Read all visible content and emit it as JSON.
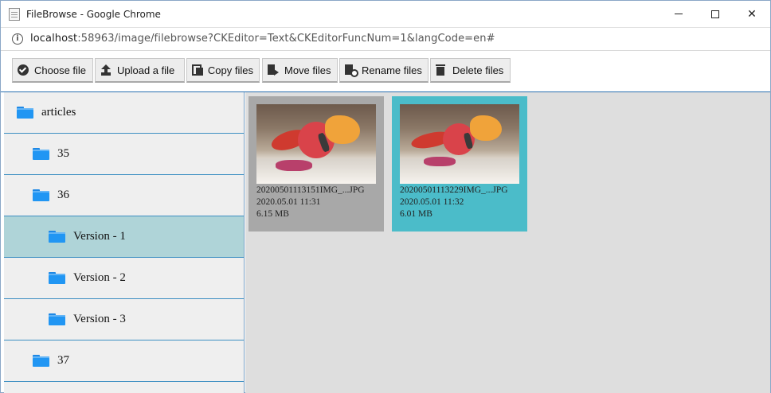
{
  "window": {
    "title": "FileBrowse - Google Chrome",
    "minimize_label": "",
    "maximize_label": "",
    "close_label": "✕"
  },
  "address": {
    "host": "localhost",
    "rest": ":58963/image/filebrowse?CKEditor=Text&CKEditorFuncNum=1&langCode=en#"
  },
  "toolbar": {
    "choose": "Choose file",
    "upload": "Upload a file",
    "copy": "Copy files",
    "move": "Move files",
    "rename": "Rename files",
    "delete": "Delete files"
  },
  "tree": {
    "items": [
      {
        "label": "articles",
        "level": 0,
        "selected": false
      },
      {
        "label": "35",
        "level": 1,
        "selected": false
      },
      {
        "label": "36",
        "level": 1,
        "selected": false
      },
      {
        "label": "Version - 1",
        "level": 2,
        "selected": true
      },
      {
        "label": "Version - 2",
        "level": 2,
        "selected": false
      },
      {
        "label": "Version - 3",
        "level": 2,
        "selected": false
      },
      {
        "label": "37",
        "level": 1,
        "selected": false
      }
    ]
  },
  "files": [
    {
      "name": "20200501113151IMG_...JPG",
      "date": "2020.05.01 11:31",
      "size": "6.15 MB",
      "selected": false
    },
    {
      "name": "20200501113229IMG_...JPG",
      "date": "2020.05.01 11:32",
      "size": "6.01 MB",
      "selected": true
    }
  ],
  "colors": {
    "selected_tree": "#afd4d8",
    "selected_file": "#4bbcc9",
    "unselected_file": "#a8a8a8",
    "folder": "#2196f3",
    "divider": "#3d8fc2"
  }
}
